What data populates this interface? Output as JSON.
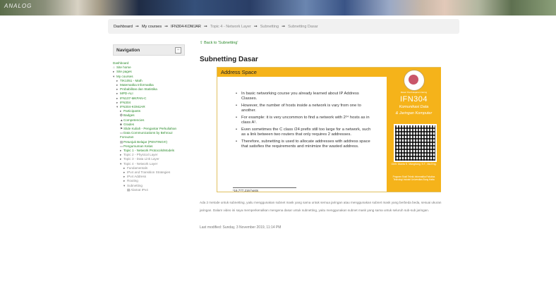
{
  "banner": {
    "text": "ANALOG"
  },
  "breadcrumb": [
    {
      "label": "Dashboard",
      "active": true
    },
    {
      "label": "My courses",
      "active": true
    },
    {
      "label": "IFN304-KOMJAR",
      "active": true
    },
    {
      "label": "Topic 4 - Network Layer",
      "active": false
    },
    {
      "label": "Subnetting",
      "active": false
    },
    {
      "label": "Subnetting Dasar",
      "active": false
    }
  ],
  "breadcrumb_sep": "➞",
  "navigation": {
    "title": "Navigation",
    "collapse_symbol": "−",
    "items": [
      {
        "label": "Dashboard",
        "icon": "",
        "indent": 0,
        "style": ""
      },
      {
        "label": "Site home",
        "icon": "⌂",
        "indent": 0,
        "style": ""
      },
      {
        "label": "Site pages",
        "icon": "▸",
        "indent": 0,
        "style": ""
      },
      {
        "label": "My courses",
        "icon": "▾",
        "indent": 0,
        "style": ""
      },
      {
        "label": "TIK1051 - Math",
        "icon": "▸",
        "indent": 1,
        "style": ""
      },
      {
        "label": "Matematika Informatika",
        "icon": "▸",
        "indent": 1,
        "style": ""
      },
      {
        "label": "Probabilitas dan Statistika",
        "icon": "▸",
        "indent": 1,
        "style": ""
      },
      {
        "label": "MPD-ALI",
        "icon": "▸",
        "indent": 1,
        "style": ""
      },
      {
        "label": "IFN107-MKPAN-C",
        "icon": "▸",
        "indent": 1,
        "style": ""
      },
      {
        "label": "IFN304",
        "icon": "▸",
        "indent": 1,
        "style": ""
      },
      {
        "label": "IFN304-KOMJAR",
        "icon": "▾",
        "indent": 1,
        "style": ""
      },
      {
        "label": "Participants",
        "icon": "▸",
        "indent": 2,
        "style": ""
      },
      {
        "label": "Badges",
        "icon": "✪",
        "indent": 2,
        "style": ""
      },
      {
        "label": "Competencies",
        "icon": "▲",
        "indent": 2,
        "style": ""
      },
      {
        "label": "Grades",
        "icon": "■",
        "indent": 2,
        "style": ""
      },
      {
        "label": "Slide Kuliah - Pengantar Perkuliahan",
        "icon": "⚑",
        "indent": 2,
        "style": "wrap"
      },
      {
        "label": "Data Communications by Behrouz Forouzan",
        "icon": "▭",
        "indent": 2,
        "style": "wrap"
      },
      {
        "label": "Petunjuk Belajar (PENTING!!!)",
        "icon": "▤",
        "indent": 2,
        "style": "wrap"
      },
      {
        "label": "Pengumuman Kelas",
        "icon": "▭",
        "indent": 2,
        "style": ""
      },
      {
        "label": "Topic 1 - Network Protocols/Models",
        "icon": "▸",
        "indent": 2,
        "style": "wrap"
      },
      {
        "label": "Topic 2 - Physical Layer",
        "icon": "▸",
        "indent": 2,
        "style": "grey"
      },
      {
        "label": "Topic 3 - Data Link Layer",
        "icon": "▸",
        "indent": 2,
        "style": "grey"
      },
      {
        "label": "Topic 4 - Network Layer",
        "icon": "▾",
        "indent": 2,
        "style": "grey"
      },
      {
        "label": "Fundamentals",
        "icon": "▸",
        "indent": 3,
        "style": "grey"
      },
      {
        "label": "IPv4 and Transition Strategies",
        "icon": "▸",
        "indent": 3,
        "style": "grey wrap"
      },
      {
        "label": "IPv4 Address",
        "icon": "▸",
        "indent": 3,
        "style": "grey"
      },
      {
        "label": "Routing",
        "icon": "▸",
        "indent": 3,
        "style": "grey"
      },
      {
        "label": "Subnetting",
        "icon": "▾",
        "indent": 3,
        "style": "grey"
      },
      {
        "label": "Alamat IPv4",
        "icon": "▤",
        "indent": 4,
        "style": "grey"
      }
    ]
  },
  "back_link": "Back to 'Subnetting'",
  "page_title": "Subnetting Dasar",
  "slide": {
    "header": "Address Space",
    "bullets": [
      "In basic networking course you already learned about IP Address Classes.",
      "However, the number of hosts inside a network is vary from one to another.",
      "For example: it is very uncommon to find a network with 2²⁴ hosts as in class A¹.",
      "Even sometimes the C class /24 prefix still too large for a network, such as a link between two routers that only requires 2 addresses.",
      "Therefore, subnetting is used to allocate addresses with address space that satisfies the requirements and minimize the wasted address."
    ],
    "footnote": "¹16,777,216 hosts",
    "side": {
      "tag": "Materi Pembelajaran Daring",
      "code": "IFN304",
      "course": "Komunikasi Data",
      "sub": "& Jaringan Komputer",
      "author": "Oleh: Dianta S. Mangitung, S.T., Ma.Eng.",
      "institution": "Program Studi Teknik Informatika Fakultas Teknologi Industri Universitas Bung Hatta"
    }
  },
  "description": "Ada 2 metode untuk subnetting, yaitu menggunakan subnet mask yang sama untuk semua jaringan atau menggunakan subnet mask yang berbeda beda, sesuai ukuran jaringan. Dalam video ini saya memperkenalkan mengena dasar untuk subnetting, yaitu menggunakan subnet mask yang sama untuk seluruh sub-sub jaringan.",
  "last_modified": "Last modified: Sunday, 3 November 2019, 11:14 PM",
  "colors": {
    "accent": "#f5b31a",
    "link": "#2b8a2b"
  }
}
